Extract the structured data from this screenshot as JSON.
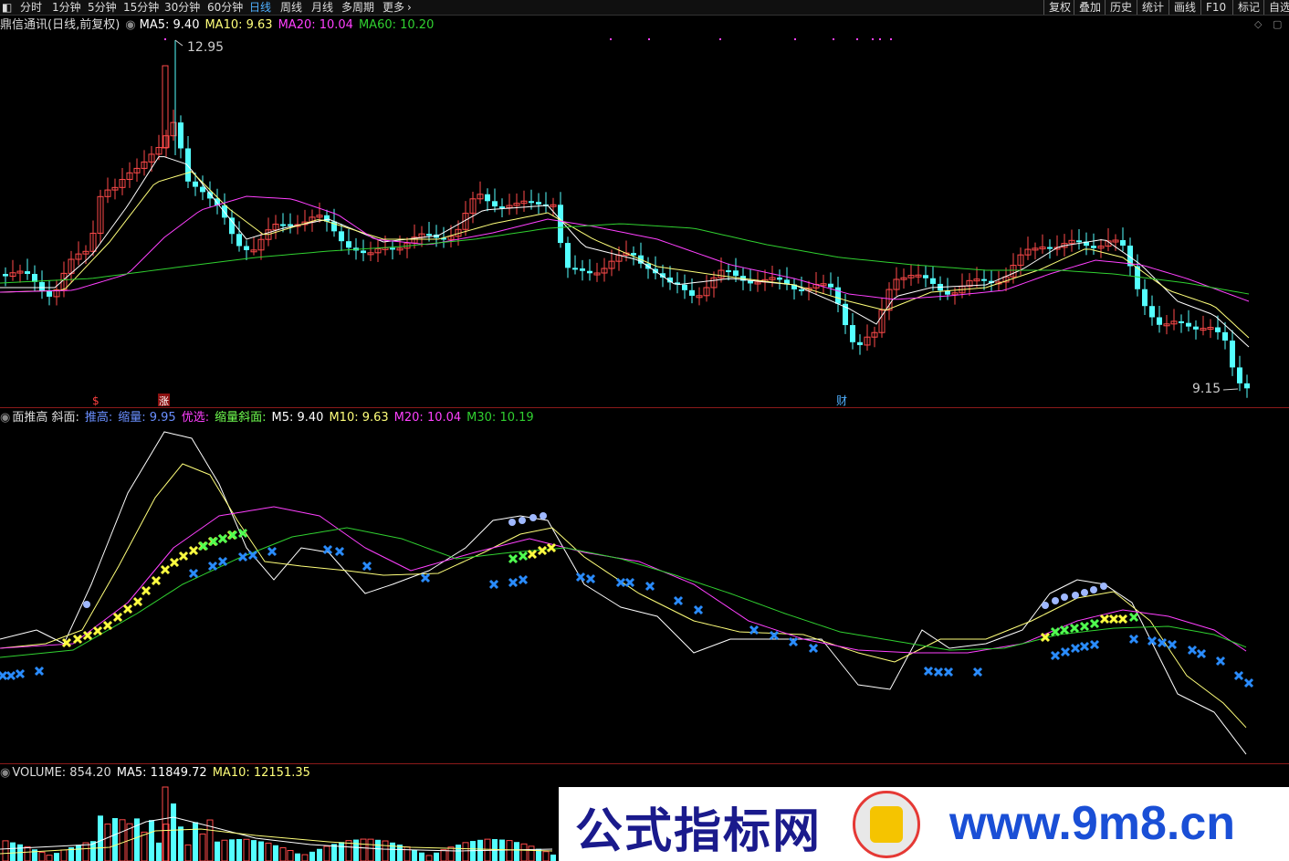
{
  "toolbar": {
    "timeframes": [
      "分时",
      "1分钟",
      "5分钟",
      "15分钟",
      "30分钟",
      "60分钟",
      "日线",
      "周线",
      "月线",
      "多周期",
      "更多"
    ],
    "active": "日线",
    "right_buttons": [
      "复权",
      "叠加",
      "历史",
      "统计",
      "画线",
      "F10",
      "标记",
      "自选"
    ]
  },
  "price_panel": {
    "title": "鼎信通讯(日线,前复权)",
    "ma5": "MA5: 9.40",
    "ma10": "MA10: 9.63",
    "ma20": "MA20: 10.04",
    "ma60": "MA60: 10.20",
    "high_label": "12.95",
    "low_label": "9.15",
    "markers": [
      "$",
      "涨",
      "财"
    ]
  },
  "indicator_panel": {
    "name": "面推高 斜面:",
    "push_high": "推高:",
    "shrink": "缩量: 9.95",
    "preferred": "优选:",
    "shrink_slope": "缩量斜面:",
    "m5": "M5: 9.40",
    "m10": "M10: 9.63",
    "m20": "M20: 10.04",
    "m30": "M30: 10.19"
  },
  "volume_panel": {
    "volume": "VOLUME: 854.20",
    "ma5": "MA5: 11849.72",
    "ma10": "MA10: 12151.35"
  },
  "watermark": {
    "brand": "公式指标网",
    "url": "www.9m8.cn"
  },
  "colors": {
    "up": "#ff4a4a",
    "down": "#54ffff",
    "ma5": "#ffffff",
    "ma10": "#ffff7a",
    "ma20": "#ff40ff",
    "ma60": "#30d030"
  }
}
